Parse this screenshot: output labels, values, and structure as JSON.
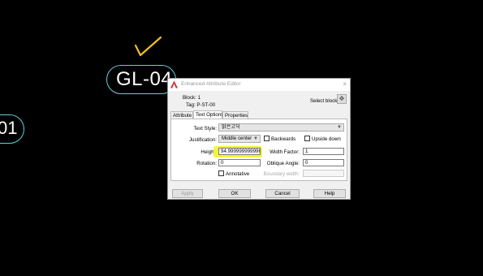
{
  "canvas": {
    "tag_text": "GL-04",
    "left_text": "01",
    "accent_color": "#5fd0d8",
    "check_color": "#f0c020"
  },
  "dialog": {
    "title": "Enhanced Attribute Editor",
    "close_icon": "×",
    "block_label": "Block: 1",
    "tag_label": "Tag: P-ST-00",
    "select_block_label": "Select block",
    "tabs": [
      {
        "label": "Attribute",
        "active": false
      },
      {
        "label": "Text Options",
        "active": true
      },
      {
        "label": "Properties",
        "active": false
      }
    ],
    "text_options": {
      "text_style_label": "Text Style:",
      "text_style_value": "맑은고딕",
      "justification_label": "Justification:",
      "justification_value": "Middle center",
      "backwards_label": "Backwards",
      "upside_down_label": "Upside down",
      "height_label": "Height:",
      "height_value": "94.9999999999964",
      "width_factor_label": "Width Factor:",
      "width_factor_value": "1",
      "rotation_label": "Rotation:",
      "rotation_value": "0",
      "oblique_angle_label": "Oblique Angle:",
      "oblique_angle_value": "0",
      "annotative_label": "Annotative",
      "boundary_width_label": "Boundary width:",
      "boundary_width_value": ""
    },
    "buttons": {
      "apply": "Apply",
      "ok": "OK",
      "cancel": "Cancel",
      "help": "Help"
    }
  }
}
